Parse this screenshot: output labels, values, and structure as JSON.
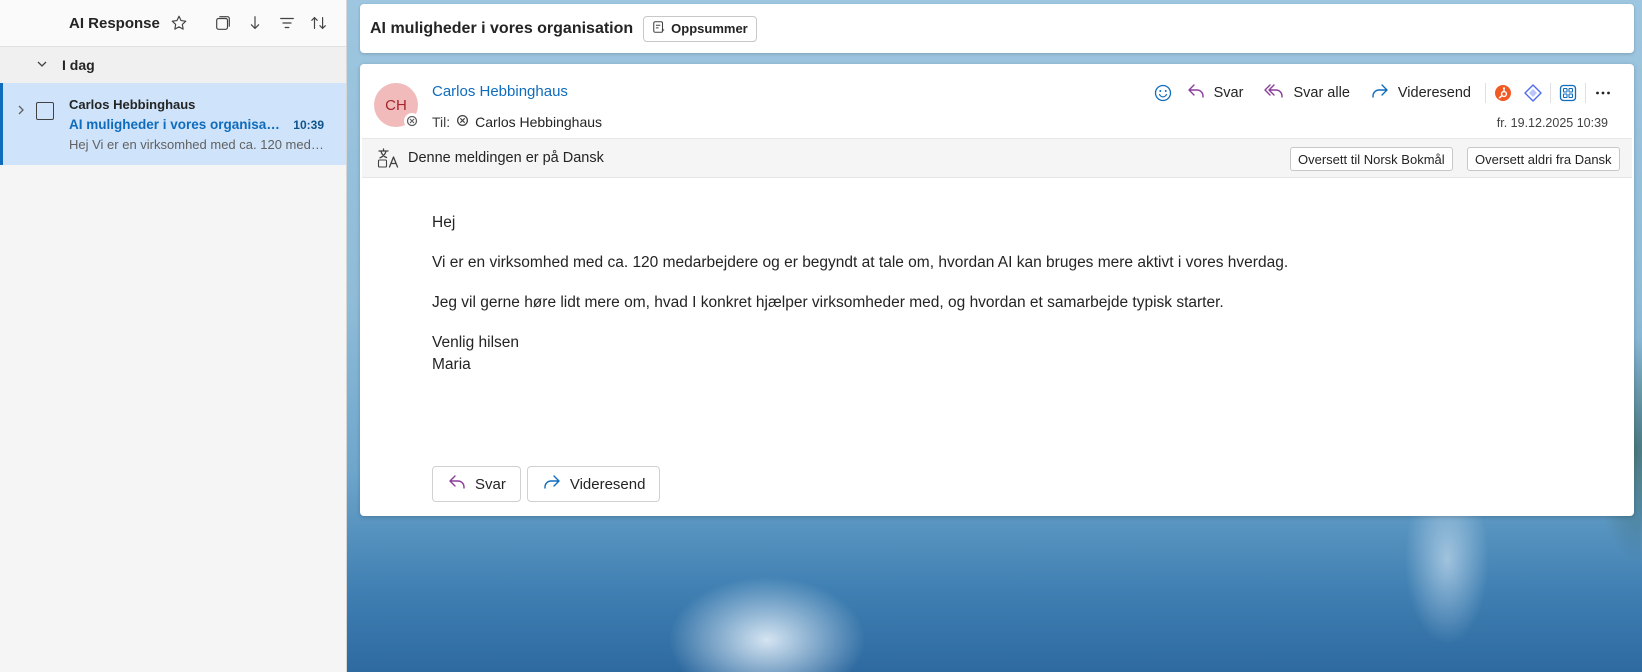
{
  "folder": {
    "title": "AI Response"
  },
  "mail_list": {
    "group_label": "I dag",
    "items": [
      {
        "sender": "Carlos Hebbinghaus",
        "subject": "AI muligheder i vores organisation",
        "time": "10:39",
        "preview": "Hej Vi er en virksomhed med ca. 120 medarbejdere og er begyndt at tale om, hvordan AI kan bruges mere aktivt i vores hverdag."
      }
    ]
  },
  "subject_bar": {
    "title": "AI muligheder i vores organisation",
    "summarize_label": "Oppsummer"
  },
  "message": {
    "avatar_initials": "CH",
    "from_name": "Carlos Hebbinghaus",
    "to_label": "Til:",
    "to_name": "Carlos Hebbinghaus",
    "date": "fr. 19.12.2025 10:39",
    "actions": {
      "reply": "Svar",
      "reply_all": "Svar alle",
      "forward": "Videresend"
    },
    "translation": {
      "notice": "Denne meldingen er på Dansk",
      "translate_button": "Oversett til Norsk Bokmål",
      "never_translate_button": "Oversett aldri fra Dansk"
    },
    "body": {
      "greeting": "Hej",
      "paragraph1": "Vi er en virksomhed med ca. 120 medarbejdere og er begyndt at tale om, hvordan AI kan bruges mere aktivt i vores hverdag.",
      "paragraph2": "Jeg vil gerne høre lidt mere om, hvad I konkret hjælper virksomheder med, og hvordan et samarbejde typisk starter.",
      "closing": "Venlig hilsen",
      "signature": "Maria"
    },
    "bottom_actions": {
      "reply": "Svar",
      "forward": "Videresend"
    }
  },
  "colors": {
    "accent": "#0f6cbd",
    "selected_item": "#cfe4fa",
    "avatar_bg": "#f1bbbc",
    "avatar_text": "#a4262c",
    "reply_icon": "#8a3d9b",
    "forward_icon": "#0f6cbd"
  }
}
